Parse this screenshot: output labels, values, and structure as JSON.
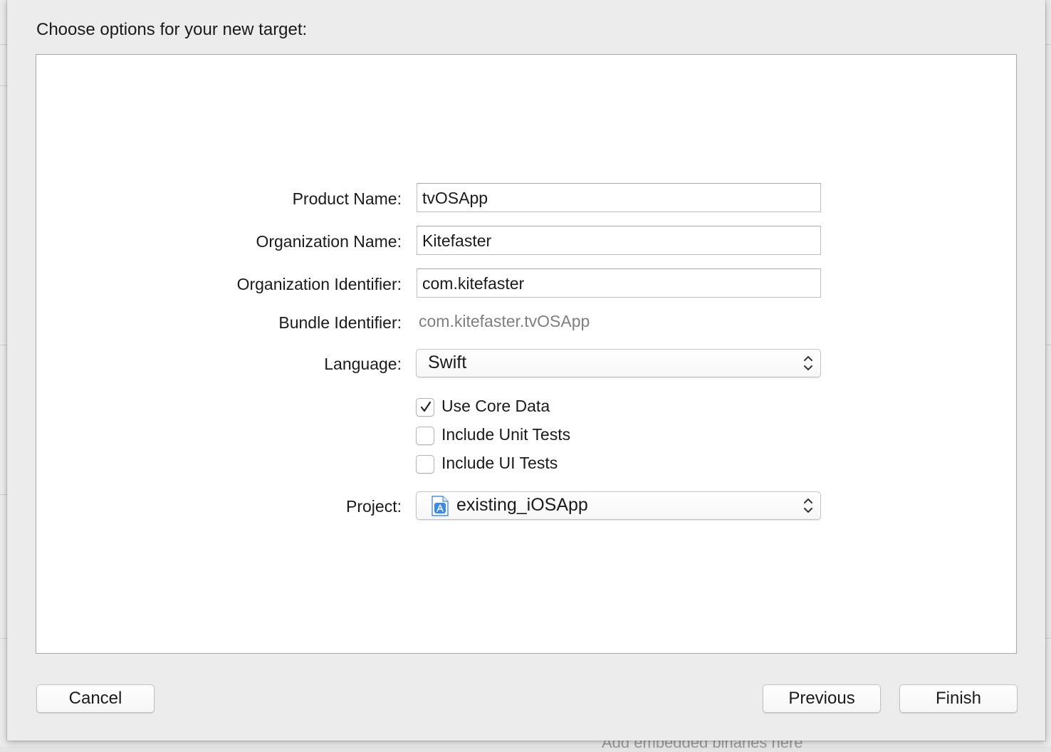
{
  "background": {
    "partial_text": "Add embedded binaries here"
  },
  "dialog": {
    "heading": "Choose options for your new target:",
    "form": {
      "product_name": {
        "label": "Product Name:",
        "value": "tvOSApp"
      },
      "organization_name": {
        "label": "Organization Name:",
        "value": "Kitefaster"
      },
      "organization_identifier": {
        "label": "Organization Identifier:",
        "value": "com.kitefaster"
      },
      "bundle_identifier": {
        "label": "Bundle Identifier:",
        "value": "com.kitefaster.tvOSApp"
      },
      "language": {
        "label": "Language:",
        "selected": "Swift",
        "icon": "up-down-arrows-icon"
      },
      "options": [
        {
          "label": "Use Core Data",
          "checked": true
        },
        {
          "label": "Include Unit Tests",
          "checked": false
        },
        {
          "label": "Include UI Tests",
          "checked": false
        }
      ],
      "project": {
        "label": "Project:",
        "selected": "existing_iOSApp",
        "icon": "xcode-project-icon"
      }
    },
    "buttons": {
      "cancel": "Cancel",
      "previous": "Previous",
      "finish": "Finish"
    },
    "colors": {
      "accent_blue": "#2f7fe0",
      "sheet_bg": "#ececec",
      "panel_bg": "#ffffff",
      "secondary_text": "#7f7f7f"
    }
  }
}
